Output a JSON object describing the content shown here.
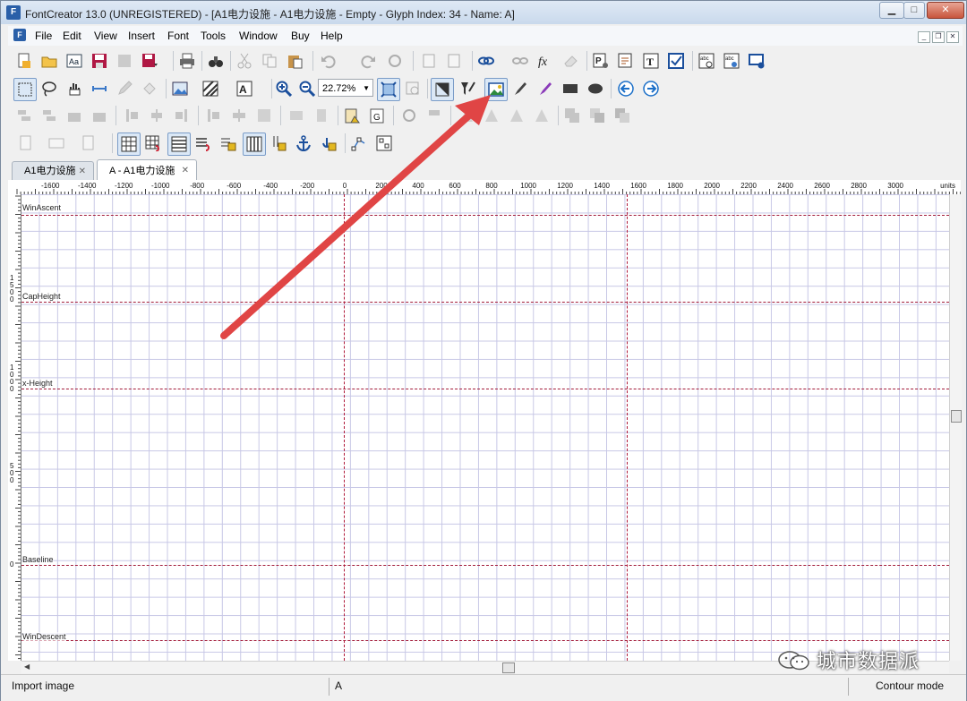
{
  "window": {
    "title": "FontCreator 13.0 (UNREGISTERED) - [A1电力设施 - A1电力设施 - Empty - Glyph Index: 34 - Name: A]",
    "app_icon": "F",
    "minimize": "▁",
    "maximize": "□",
    "close": "✕"
  },
  "menu": {
    "items": [
      "File",
      "Edit",
      "View",
      "Insert",
      "Font",
      "Tools",
      "Window",
      "Buy",
      "Help"
    ],
    "mdi_minimize": "_",
    "mdi_restore": "❐",
    "mdi_close": "✕"
  },
  "toolbar": {
    "zoom_value": "22.72%",
    "zoom_arrow": "▼"
  },
  "tabs": [
    {
      "label": "A1电力设施",
      "close": "✕"
    },
    {
      "label": "A - A1电力设施",
      "close": "✕"
    }
  ],
  "ruler": {
    "h_labels": [
      "-1600",
      "-1400",
      "-1200",
      "-1000",
      "-800",
      "-600",
      "-400",
      "-200",
      "0",
      "200",
      "400",
      "600",
      "800",
      "1000",
      "1200",
      "1400",
      "1600",
      "1800",
      "2000",
      "2200",
      "2400",
      "2600",
      "2800",
      "3000"
    ],
    "units": "units",
    "v_labels": [
      "1500",
      "1000",
      "500",
      "0"
    ]
  },
  "metrics": {
    "win_ascent": "WinAscent",
    "cap_height": "CapHeight",
    "x_height": "x-Height",
    "baseline": "Baseline",
    "win_descent": "WinDescent"
  },
  "colors": {
    "metric_line": "#a31d3b",
    "grid": "#c8c8e6",
    "annotation_arrow": "#e04545"
  },
  "status": {
    "hint": "Import image",
    "glyph": "A",
    "mode": "Contour mode"
  },
  "watermark": "城市数据派"
}
